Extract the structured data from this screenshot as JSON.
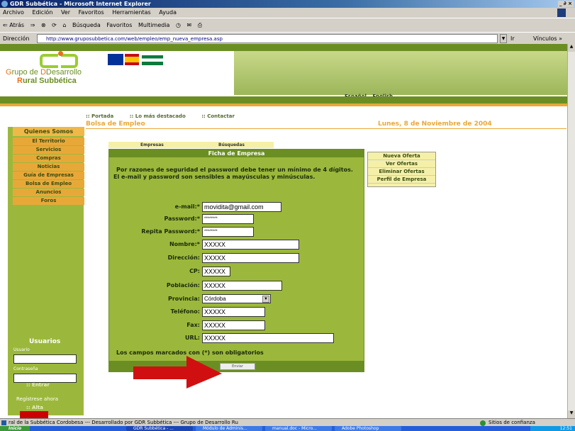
{
  "window": {
    "title": "GDR Subbética - Microsoft Internet Explorer",
    "controls": "_ ∂ ×"
  },
  "menubar": [
    "Archivo",
    "Edición",
    "Ver",
    "Favoritos",
    "Herramientas",
    "Ayuda"
  ],
  "toolbar": {
    "back": "⇐ Atrás",
    "forward": "⇒",
    "search": "Búsqueda",
    "favorites": "Favoritos",
    "multimedia": "Multimedia"
  },
  "address": {
    "label": "Dirección",
    "url": "http://www.gruposubbetica.com/web/empleo/emp_nueva_empresa.asp",
    "go": "Ir",
    "links": "Vínculos »"
  },
  "header": {
    "title_part1": "rupo de ",
    "title_g": "G",
    "title_part2": "Desarrollo",
    "title_r": "R",
    "title_part3": "ural Subbética",
    "lang_es": "Español",
    "lang_en": "English"
  },
  "topnav": [
    "Portada",
    "Lo más destacado",
    "Contactar"
  ],
  "section": {
    "title": "Bolsa de Empleo",
    "date": "Lunes, 8 de Noviembre de 2004"
  },
  "sidebar": {
    "items": [
      "Quienes Somos",
      "El Territorio",
      "Servicios",
      "Compras",
      "Noticias",
      "Guía de Empresas",
      "Bolsa de Empleo",
      "Anuncios",
      "Foros"
    ],
    "users_title": "Usuarios",
    "user_label": "Usuario",
    "password_label": "Contraseña",
    "enter": ":: Entrar",
    "register": "Regístrese ahora",
    "signup": ":: Alta"
  },
  "tabs": {
    "empresas": "Empresas",
    "busquedas": "Búsquedas"
  },
  "form": {
    "header": "Ficha de Empresa",
    "notice_line1": "Por razones de seguridad el password debe tener un mínimo de 4 dígitos.",
    "notice_line2": "El e-mail y password son sensibles a mayúsculas y minúsculas.",
    "fields": [
      {
        "label": "e-mail:*",
        "value": "movidita@gmail.com"
      },
      {
        "label": "Password:*",
        "value": "********"
      },
      {
        "label": "Repita Password:*",
        "value": "********"
      },
      {
        "label": "Nombre:*",
        "value": "XXXXX"
      },
      {
        "label": "Dirección:",
        "value": "XXXXX"
      },
      {
        "label": "CP:",
        "value": "XXXXX"
      },
      {
        "label": "Población:",
        "value": "XXXXX"
      },
      {
        "label": "Provincia:",
        "value": "Córdoba"
      },
      {
        "label": "Teléfono:",
        "value": "XXXXX"
      },
      {
        "label": "Fax:",
        "value": "XXXXX"
      },
      {
        "label": "URL:",
        "value": "XXXXX"
      }
    ],
    "required_note": "Los campos marcados con (*) son obligatorios",
    "submit": "Enviar"
  },
  "right_menu": [
    "Nueva Oferta",
    "Ver Ofertas",
    "Eliminar Ofertas",
    "Perfil de Empresa"
  ],
  "status": {
    "text": "ral de la Subbética Cordobesa --- Desarrollado por GDR Subbética --- Grupo de Desarrollo Ru",
    "zone": "Sitios de confianza"
  },
  "taskbar": {
    "start": "Inicio",
    "tasks": [
      "GDR Subbética - ...",
      "Módulo de Adminis...",
      "manual.doc - Micro...",
      "Adobe Photoshop"
    ],
    "clock": "12:51"
  },
  "colors": {
    "green": "#9cb83c",
    "dark_green": "#6b8e23",
    "orange": "#e8a838",
    "red_arrow": "#d01010"
  }
}
